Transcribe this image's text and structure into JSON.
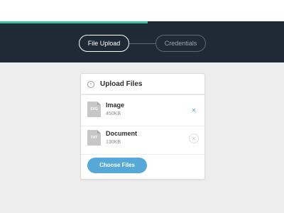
{
  "progress": {
    "fraction": 0.52,
    "color": "#3fc1a5"
  },
  "steps": [
    {
      "label": "File Upload",
      "active": true
    },
    {
      "label": "Credentials",
      "active": false
    }
  ],
  "card": {
    "title": "Upload Files",
    "back_icon": "chevron-left-icon",
    "files": [
      {
        "name": "Image",
        "size": "450KB",
        "ext": "SVG",
        "remove_icon": "close-icon"
      },
      {
        "name": "Document",
        "size": "130KB",
        "ext": "TXT",
        "remove_icon": "close-icon"
      }
    ],
    "choose_label": "Choose Files"
  },
  "colors": {
    "header_bg": "#1f2a36",
    "accent": "#56a8d8",
    "progress": "#3fc1a5"
  }
}
